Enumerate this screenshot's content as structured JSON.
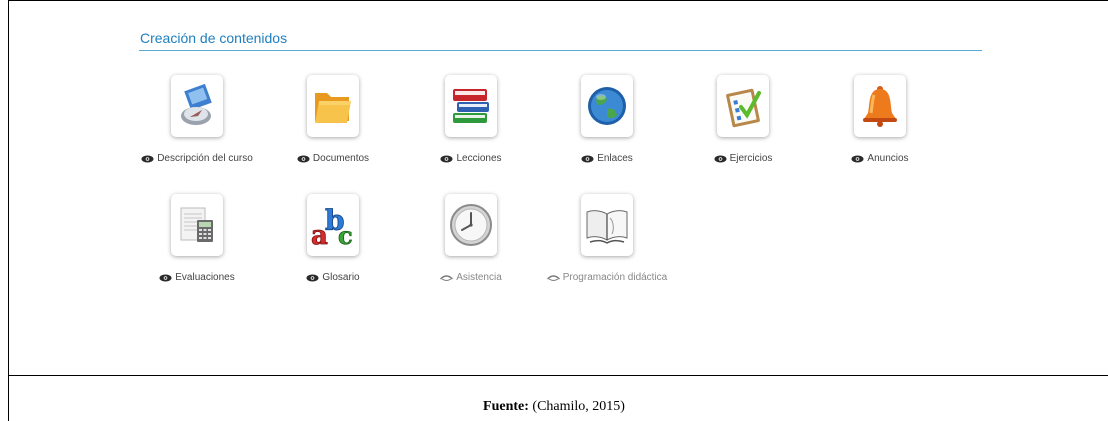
{
  "section": {
    "title": "Creación de contenidos"
  },
  "tools": [
    {
      "label": "Descripción del curso",
      "icon": "compass-icon",
      "visible": true
    },
    {
      "label": "Documentos",
      "icon": "folder-icon",
      "visible": true
    },
    {
      "label": "Lecciones",
      "icon": "books-icon",
      "visible": true
    },
    {
      "label": "Enlaces",
      "icon": "globe-icon",
      "visible": true
    },
    {
      "label": "Ejercicios",
      "icon": "checklist-icon",
      "visible": true
    },
    {
      "label": "Anuncios",
      "icon": "bell-icon",
      "visible": true
    },
    {
      "label": "Evaluaciones",
      "icon": "calculator-icon",
      "visible": true
    },
    {
      "label": "Glosario",
      "icon": "abc-icon",
      "visible": true
    },
    {
      "label": "Asistencia",
      "icon": "clock-icon",
      "visible": false
    },
    {
      "label": "Programación didáctica",
      "icon": "open-book-icon",
      "visible": false
    }
  ],
  "caption": {
    "label": "Fuente:",
    "text": " (Chamilo, 2015)"
  },
  "colors": {
    "accent": "#1f7fbf",
    "eye_visible": "#2a2a2a",
    "eye_hidden": "#777777"
  }
}
